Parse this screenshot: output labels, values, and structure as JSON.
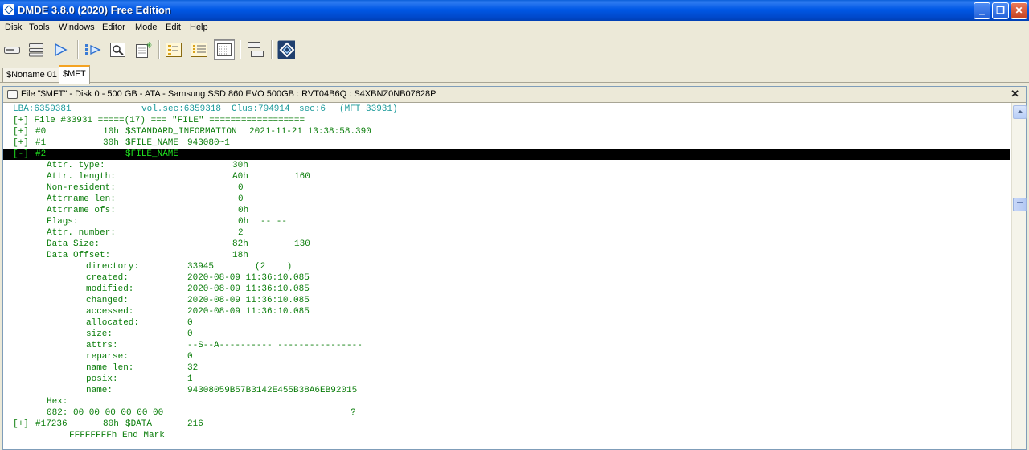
{
  "window": {
    "title": "DMDE 3.8.0 (2020) Free Edition"
  },
  "menu": [
    "Disk",
    "Tools",
    "Windows",
    "Editor",
    "Mode",
    "Edit",
    "Help"
  ],
  "toolbar": {
    "icons": [
      "disk-icon",
      "partitions-icon",
      "play-icon",
      "go-to-icon",
      "search-icon",
      "new-document-icon",
      "file-panel-icon",
      "list-view-icon",
      "grid-view-icon",
      "split-window-icon",
      "dmde-logo-icon"
    ],
    "pressed": "grid-view-icon"
  },
  "tabs": [
    {
      "label": "$Noname 01",
      "active": false
    },
    {
      "label": "$MFT",
      "active": true
    }
  ],
  "panel": {
    "header": "File \"$MFT\" - Disk 0 - 500 GB - ATA - Samsung SSD 860 EVO 500GB : RVT04B6Q : S4XBNZ0NB07628P",
    "close_label": "✕"
  },
  "editor": {
    "lba_line": {
      "lba": "LBA:6359381",
      "volsec": "vol.sec:6359318",
      "clus": "Clus:794914",
      "sec": "sec:6",
      "mft": "(MFT 33931)"
    },
    "file_header": "[+] File #33931 =====(17) === \"FILE\" ==================",
    "attributes": [
      {
        "toggle": "[+]",
        "num": "#0",
        "offset": "10h",
        "name": "$STANDARD_INFORMATION",
        "value": "2021-11-21 13:38:58.390"
      },
      {
        "toggle": "[+]",
        "num": "#1",
        "offset": "30h",
        "name": "$FILE_NAME",
        "value": "943080~1"
      }
    ],
    "selected": {
      "toggle": "[-]",
      "num": "#2",
      "name": "$FILE_NAME"
    },
    "fields": [
      {
        "label": "Attr. type:",
        "hex": "30h",
        "dec": ""
      },
      {
        "label": "Attr. length:",
        "hex": "A0h",
        "dec": "160"
      },
      {
        "label": "Non-resident:",
        "hex": "0",
        "dec": ""
      },
      {
        "label": "Attrname len:",
        "hex": "0",
        "dec": ""
      },
      {
        "label": "Attrname ofs:",
        "hex": "0h",
        "dec": ""
      },
      {
        "label": "Flags:",
        "hex": "0h",
        "dec": "-- --"
      },
      {
        "label": "Attr. number:",
        "hex": "2",
        "dec": ""
      },
      {
        "label": "Data Size:",
        "hex": "82h",
        "dec": "130"
      },
      {
        "label": "Data Offset:",
        "hex": "18h",
        "dec": ""
      }
    ],
    "filename": [
      {
        "label": "directory:",
        "value": "33945",
        "extra": "(2    )"
      },
      {
        "label": "created:",
        "value": "2020-08-09 11:36:10.085"
      },
      {
        "label": "modified:",
        "value": "2020-08-09 11:36:10.085"
      },
      {
        "label": "changed:",
        "value": "2020-08-09 11:36:10.085"
      },
      {
        "label": "accessed:",
        "value": "2020-08-09 11:36:10.085"
      },
      {
        "label": "allocated:",
        "value": "0"
      },
      {
        "label": "size:",
        "value": "0"
      },
      {
        "label": "attrs:",
        "value": "--S--A---------- ----------------"
      },
      {
        "label": "reparse:",
        "value": "0"
      },
      {
        "label": "name len:",
        "value": "32"
      },
      {
        "label": "posix:",
        "value": "1"
      },
      {
        "label": "name:",
        "value": "94308059B57B3142E455B38A6EB92015"
      }
    ],
    "hex_label": "Hex:",
    "hex_line": {
      "addr": "082: 00 00 00 00 00 00",
      "ascii": "?"
    },
    "data_attr": {
      "toggle": "[+]",
      "num": "#17236",
      "offset": "80h",
      "name": "$DATA",
      "value": "216"
    },
    "end_mark": "FFFFFFFFh End Mark"
  },
  "colors": {
    "text_green": "#0a7d0a",
    "teal": "#1a9a9a",
    "selected_bg": "#000000",
    "selected_fg": "#1fe01f"
  }
}
